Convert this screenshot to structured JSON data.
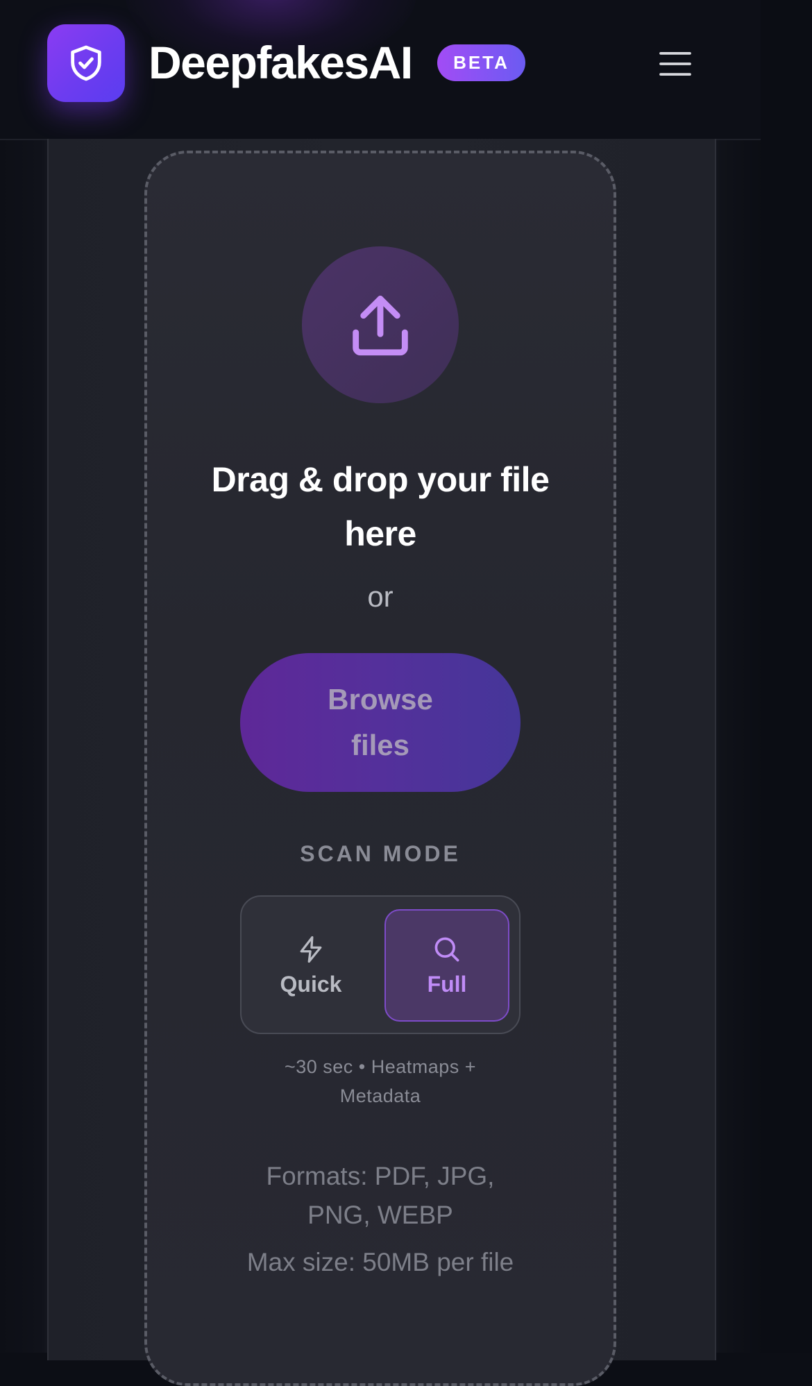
{
  "header": {
    "brand": "DeepfakesAI",
    "badge": "BETA",
    "logo_icon": "shield-check-icon",
    "menu_icon": "hamburger-menu-icon"
  },
  "upload": {
    "icon": "upload-icon",
    "title": "Drag & drop your file here",
    "or": "or",
    "browse_label": "Browse files"
  },
  "scan_mode": {
    "label": "SCAN MODE",
    "options": [
      {
        "label": "Quick",
        "icon": "lightning-bolt-icon",
        "selected": false
      },
      {
        "label": "Full",
        "icon": "magnifier-icon",
        "selected": true
      }
    ],
    "description": "~30 sec • Heatmaps + Metadata"
  },
  "info": {
    "formats": "Formats: PDF, JPG, PNG, WEBP",
    "max_size": "Max size: 50MB per file"
  },
  "colors": {
    "accent": "#7c3aed",
    "accent_light": "#c08cf7",
    "background": "#0c0e15",
    "panel": "#22242c"
  }
}
